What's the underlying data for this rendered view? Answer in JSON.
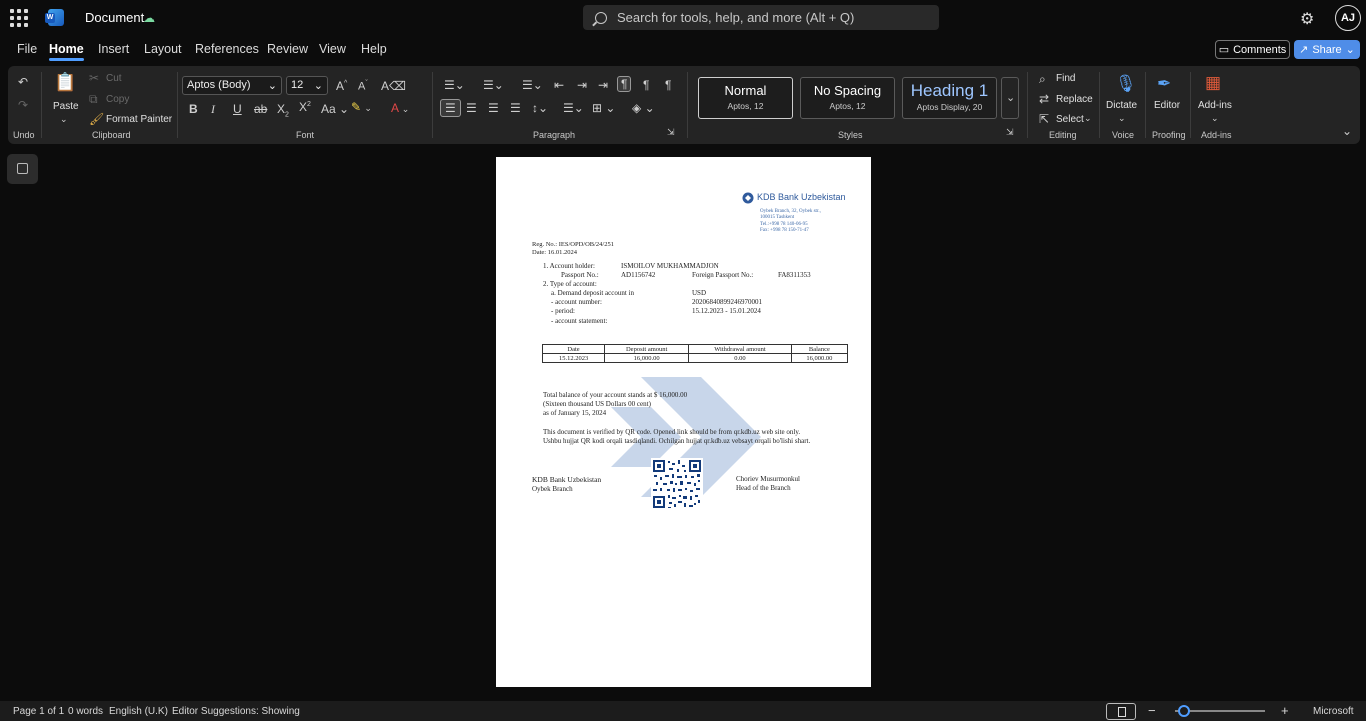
{
  "app": {
    "document_title": "Document",
    "search_placeholder": "Search for tools, help, and more (Alt + Q)",
    "user_initials": "AJ",
    "accent_color": "#4f9dff"
  },
  "menu": {
    "tabs": [
      "File",
      "Home",
      "Insert",
      "Layout",
      "References",
      "Review",
      "View",
      "Help"
    ],
    "active": "Home",
    "comments_label": "Comments",
    "share_label": "Share"
  },
  "ribbon": {
    "undo_label": "Undo",
    "clipboard": {
      "paste": "Paste",
      "cut": "Cut",
      "copy": "Copy",
      "format_painter": "Format Painter",
      "label": "Clipboard"
    },
    "font": {
      "name": "Aptos (Body)",
      "size": "12",
      "label": "Font"
    },
    "paragraph_label": "Paragraph",
    "styles": {
      "label": "Styles",
      "items": [
        {
          "name": "Normal",
          "sub": "Aptos, 12"
        },
        {
          "name": "No Spacing",
          "sub": "Aptos, 12"
        },
        {
          "name": "Heading 1",
          "sub": "Aptos Display, 20"
        }
      ]
    },
    "editing": {
      "find": "Find",
      "replace": "Replace",
      "select": "Select",
      "label": "Editing"
    },
    "voice": {
      "dictate": "Dictate",
      "label": "Voice"
    },
    "proofing": {
      "editor": "Editor",
      "label": "Proofing"
    },
    "addins": {
      "addins": "Add-ins",
      "label": "Add-ins"
    }
  },
  "document": {
    "bank_name": "KDB Bank Uzbekistan",
    "address": [
      "Oybek Branch, 32, Oybek str.,",
      "100015 Tashkent",
      "Tel.:+998 78 140-06-95",
      "Fax: +998 78 150-71-47"
    ],
    "reg_no": "Reg. No.: IES/OPD/OB/24/251",
    "date": "Date: 16.01.2024",
    "holder_label": "1. Account holder:",
    "holder_value": "ISMOILOV MUKHAMMADJON",
    "passport_label": "Passport No.:",
    "passport_value": "AD1156742",
    "foreign_passport_label": "Foreign Passport No.:",
    "foreign_passport_value": "FA8311353",
    "type_label": "2. Type of account:",
    "demand_label": "a. Demand deposit account in",
    "demand_value": "USD",
    "account_number_label": "- account number:",
    "account_number_value": "20206840899246970001",
    "period_label": "- period:",
    "period_value": "15.12.2023 - 15.01.2024",
    "statement_label": "- account statement:",
    "table": {
      "headers": [
        "Date",
        "Deposit amount",
        "Withdrawal amount",
        "Balance"
      ],
      "rows": [
        [
          "15.12.2023",
          "16,000.00",
          "0.00",
          "16,000.00"
        ]
      ]
    },
    "balance_line1": "Total balance of your account stands at  $ 16,000.00",
    "balance_line2": "(Sixteen thousand US Dollars 00 cent)",
    "balance_line3": "as of January 15, 2024",
    "verify_line1": "This document is verified by QR code. Opened link should be from qr.kdb.uz web site only.",
    "verify_line2": "Ushbu hujjat QR kodi orqali tasdiqlandi. Ochilgan hujjat qr.kdb.uz vebsayt orqali bo'lishi shart.",
    "sign_left1": "KDB Bank Uzbekistan",
    "sign_left2": "Oybek Branch",
    "sign_right1": "Choriev Musurmonkul",
    "sign_right2": "Head of the Branch"
  },
  "status": {
    "page": "Page 1 of 1",
    "words": "0 words",
    "language": "English (U.K)",
    "suggestions": "Editor Suggestions: Showing",
    "zoom_minus": "−",
    "zoom_plus": "+",
    "brand": "Microsoft"
  }
}
